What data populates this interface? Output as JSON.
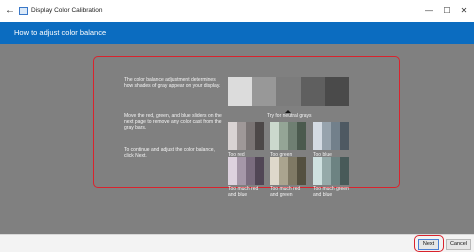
{
  "window": {
    "title": "Display Color Calibration",
    "back": "←",
    "minimize": "—",
    "maximize": "☐",
    "close": "✕"
  },
  "header": {
    "title": "How to adjust color balance"
  },
  "instructions": [
    "The color balance adjustment determines how shades of gray appear on your display.",
    "Move the red, green, and blue sliders on the next page to remove any color cast from the gray bars.",
    "To continue and adjust the color balance, click Next."
  ],
  "neutral_grays": {
    "label": "Try for neutral grays",
    "shades": [
      "#dcdcdc",
      "#989898",
      "#7c7c7c",
      "#5f5f5f",
      "#4a4a4a"
    ]
  },
  "samples": [
    {
      "label": "Too red",
      "stripes": [
        "#d9d3d3",
        "#9f9898",
        "#7a7474",
        "#4d4848"
      ]
    },
    {
      "label": "Too green",
      "stripes": [
        "#cbd9cd",
        "#94a596",
        "#6f7f72",
        "#4b5a4e"
      ]
    },
    {
      "label": "Too blue",
      "stripes": [
        "#d4dbe3",
        "#97a3ad",
        "#72808b",
        "#4e5962"
      ]
    },
    {
      "label": "Too much red and blue",
      "stripes": [
        "#ddd2de",
        "#a597a8",
        "#7a6c7e",
        "#514655"
      ]
    },
    {
      "label": "Too much red and green",
      "stripes": [
        "#ded8cb",
        "#aaa48f",
        "#7f7965",
        "#545040"
      ]
    },
    {
      "label": "Too much green and blue",
      "stripes": [
        "#cfe1e0",
        "#95aaa9",
        "#6d8382",
        "#485a59"
      ]
    }
  ],
  "buttons": {
    "next": "Next",
    "cancel": "Cancel"
  }
}
